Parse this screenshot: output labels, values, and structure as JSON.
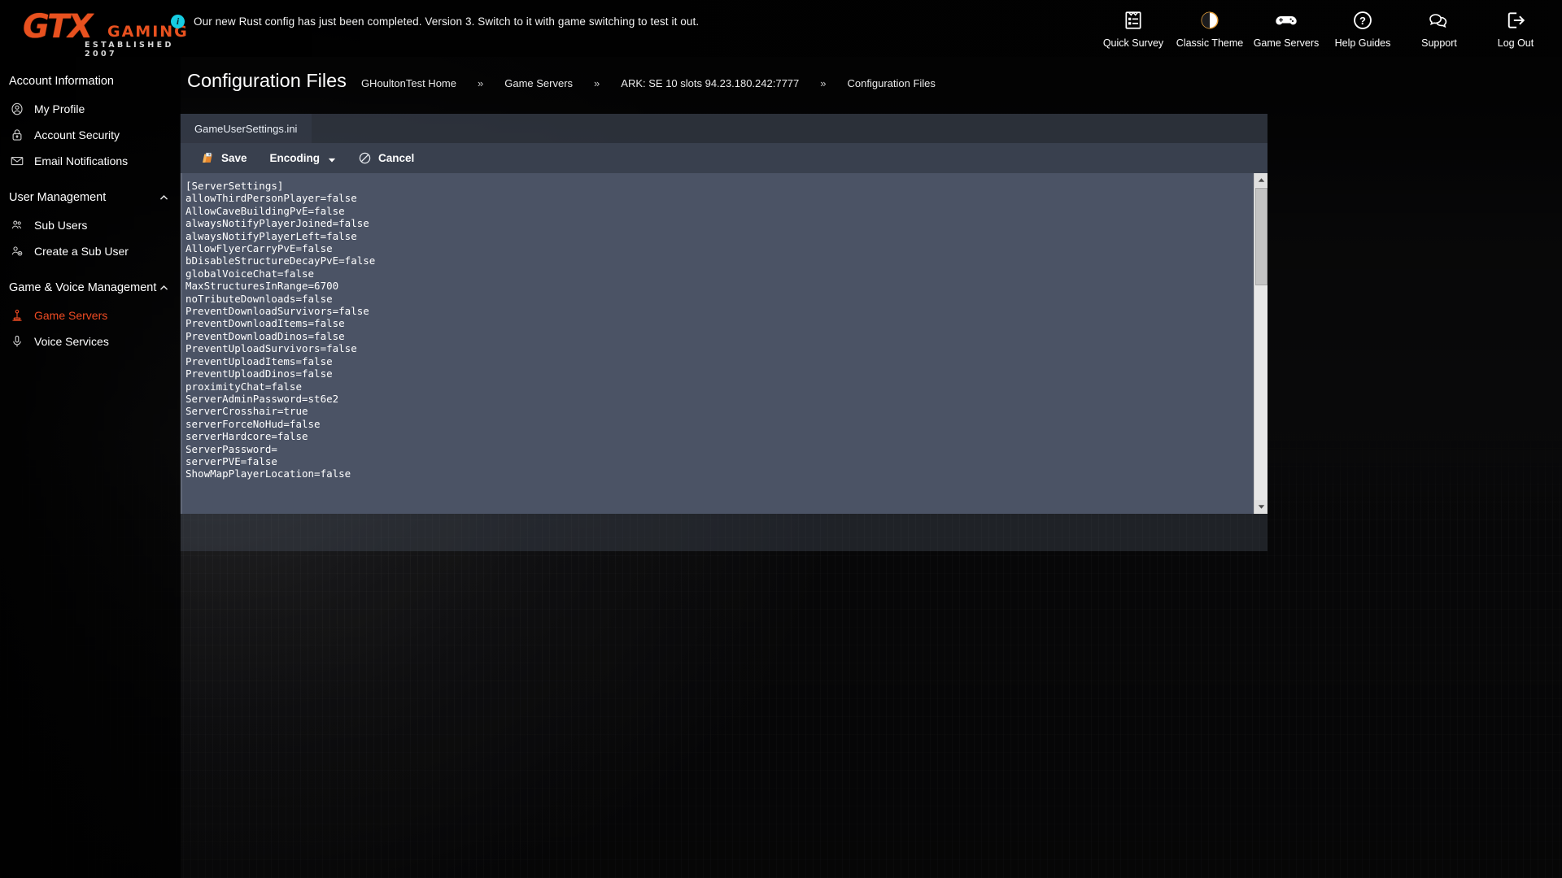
{
  "brand": {
    "gtx": "GTX",
    "gaming": "GAMING",
    "established": "ESTABLISHED 2007",
    "accent_color": "#e8511f"
  },
  "notification": {
    "icon": "info-icon",
    "text": "Our new Rust config has just been completed. Version 3. Switch to it with game switching to test it out.",
    "icon_color": "#16cde2"
  },
  "header_nav": [
    {
      "label": "Quick Survey",
      "icon": "survey-icon"
    },
    {
      "label": "Classic Theme",
      "icon": "contrast-icon"
    },
    {
      "label": "Game Servers",
      "icon": "gamepad-icon"
    },
    {
      "label": "Help Guides",
      "icon": "question-circle-icon"
    },
    {
      "label": "Support",
      "icon": "comments-icon"
    },
    {
      "label": "Log Out",
      "icon": "logout-icon"
    }
  ],
  "sidebar": {
    "groups": [
      {
        "heading": "Account Information",
        "collapsible": false,
        "items": [
          {
            "label": "My Profile",
            "icon": "user-circle-icon",
            "active": false
          },
          {
            "label": "Account Security",
            "icon": "lock-icon",
            "active": false
          },
          {
            "label": "Email Notifications",
            "icon": "envelope-icon",
            "active": false
          }
        ]
      },
      {
        "heading": "User Management",
        "collapsible": true,
        "items": [
          {
            "label": "Sub Users",
            "icon": "users-icon",
            "active": false
          },
          {
            "label": "Create a Sub User",
            "icon": "user-plus-icon",
            "active": false
          }
        ]
      },
      {
        "heading": "Game & Voice Management",
        "collapsible": true,
        "items": [
          {
            "label": "Game Servers",
            "icon": "joystick-icon",
            "active": true
          },
          {
            "label": "Voice Services",
            "icon": "microphone-icon",
            "active": false
          }
        ]
      }
    ],
    "active_color": "#ef4b23"
  },
  "page": {
    "title": "Configuration Files",
    "breadcrumbs": [
      "GHoultonTest Home",
      "Game Servers",
      "ARK: SE 10 slots 94.23.180.242:7777",
      "Configuration Files"
    ],
    "breadcrumb_separator": "»"
  },
  "editor": {
    "tab_label": "GameUserSettings.ini",
    "toolbar": {
      "save_label": "Save",
      "save_icon": "save-disk-icon",
      "encoding_label": "Encoding",
      "encoding_caret": "chevron-down-icon",
      "cancel_label": "Cancel",
      "cancel_icon": "ban-circle-icon"
    },
    "content": "[ServerSettings]\nallowThirdPersonPlayer=false\nAllowCaveBuildingPvE=false\nalwaysNotifyPlayerJoined=false\nalwaysNotifyPlayerLeft=false\nAllowFlyerCarryPvE=false\nbDisableStructureDecayPvE=false\nglobalVoiceChat=false\nMaxStructuresInRange=6700\nnoTributeDownloads=false\nPreventDownloadSurvivors=false\nPreventDownloadItems=false\nPreventDownloadDinos=false\nPreventUploadSurvivors=false\nPreventUploadItems=false\nPreventUploadDinos=false\nproximityChat=false\nServerAdminPassword=st6e2\nServerCrosshair=true\nserverForceNoHud=false\nserverHardcore=false\nServerPassword=\nserverPVE=false\nShowMapPlayerLocation=false",
    "scrollbar": {
      "up_arrow": "chevron-up-icon",
      "down_arrow": "chevron-down-icon"
    }
  }
}
